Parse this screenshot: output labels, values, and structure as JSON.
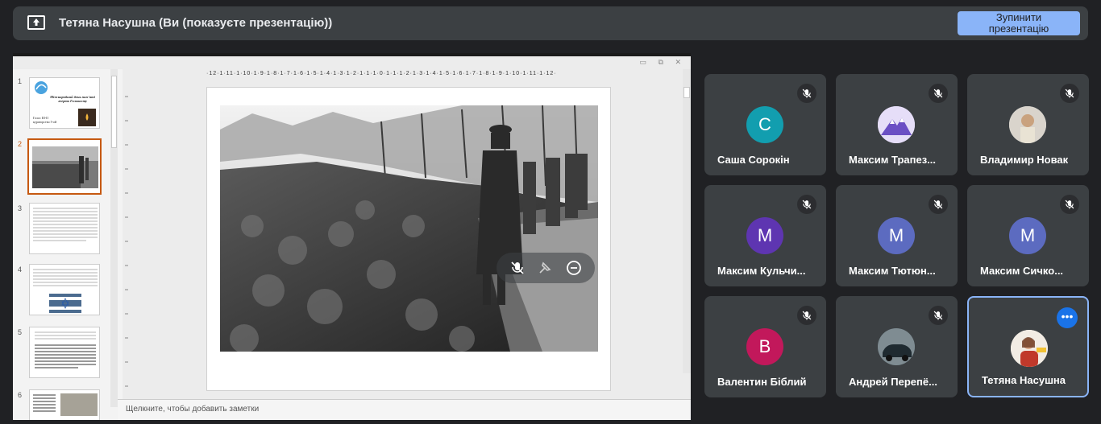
{
  "banner": {
    "icon": "present-to-all-icon",
    "title": "Тетяна Насушна (Ви (показуєте презентацію))",
    "stop_label_line1": "Зупинити",
    "stop_label_line2": "презентацію"
  },
  "presentation": {
    "thumbnails": [
      {
        "num": "1",
        "title": "Міжнародний день пам'яті жертв Голокосту",
        "text": "Голос ІІІ-ІІ кураторство 5-ой"
      },
      {
        "num": "2"
      },
      {
        "num": "3"
      },
      {
        "num": "4"
      },
      {
        "num": "5"
      },
      {
        "num": "6"
      }
    ],
    "ruler_h": "·12·1·11·1·10·1·9·1·8·1·7·1·6·1·5·1·4·1·3·1·2·1·1·1·0·1·1·1·2·1·3·1·4·1·5·1·6·1·7·1·8·1·9·1·10·1·11·1·12·",
    "notes_placeholder": "Щелкните, чтобы добавить заметки"
  },
  "participants": [
    {
      "name": "Саша Сорокін",
      "initial": "С",
      "avatar_color": "#129eaf",
      "muted": true
    },
    {
      "name": "Максим Трапез...",
      "initial": "",
      "avatar_color": "#d7cff5",
      "muted": true
    },
    {
      "name": "Владимир Новак",
      "initial": "",
      "avatar_color": "#cfd8dc",
      "muted": true
    },
    {
      "name": "Максим Кульчи...",
      "initial": "М",
      "avatar_color": "#5e35b1",
      "muted": true
    },
    {
      "name": "Максим Тютюн...",
      "initial": "М",
      "avatar_color": "#5c6bc0",
      "muted": true
    },
    {
      "name": "Максим Сичко...",
      "initial": "М",
      "avatar_color": "#5c6bc0",
      "muted": true
    },
    {
      "name": "Валентин Біблий",
      "initial": "В",
      "avatar_color": "#c2185b",
      "muted": true
    },
    {
      "name": "Андрей Перепё...",
      "initial": "",
      "avatar_color": "#455a64",
      "muted": true
    },
    {
      "name": "Тетяна Насушна",
      "initial": "",
      "avatar_color": "#f0e6dc",
      "muted": false,
      "more_label": "•••"
    }
  ]
}
